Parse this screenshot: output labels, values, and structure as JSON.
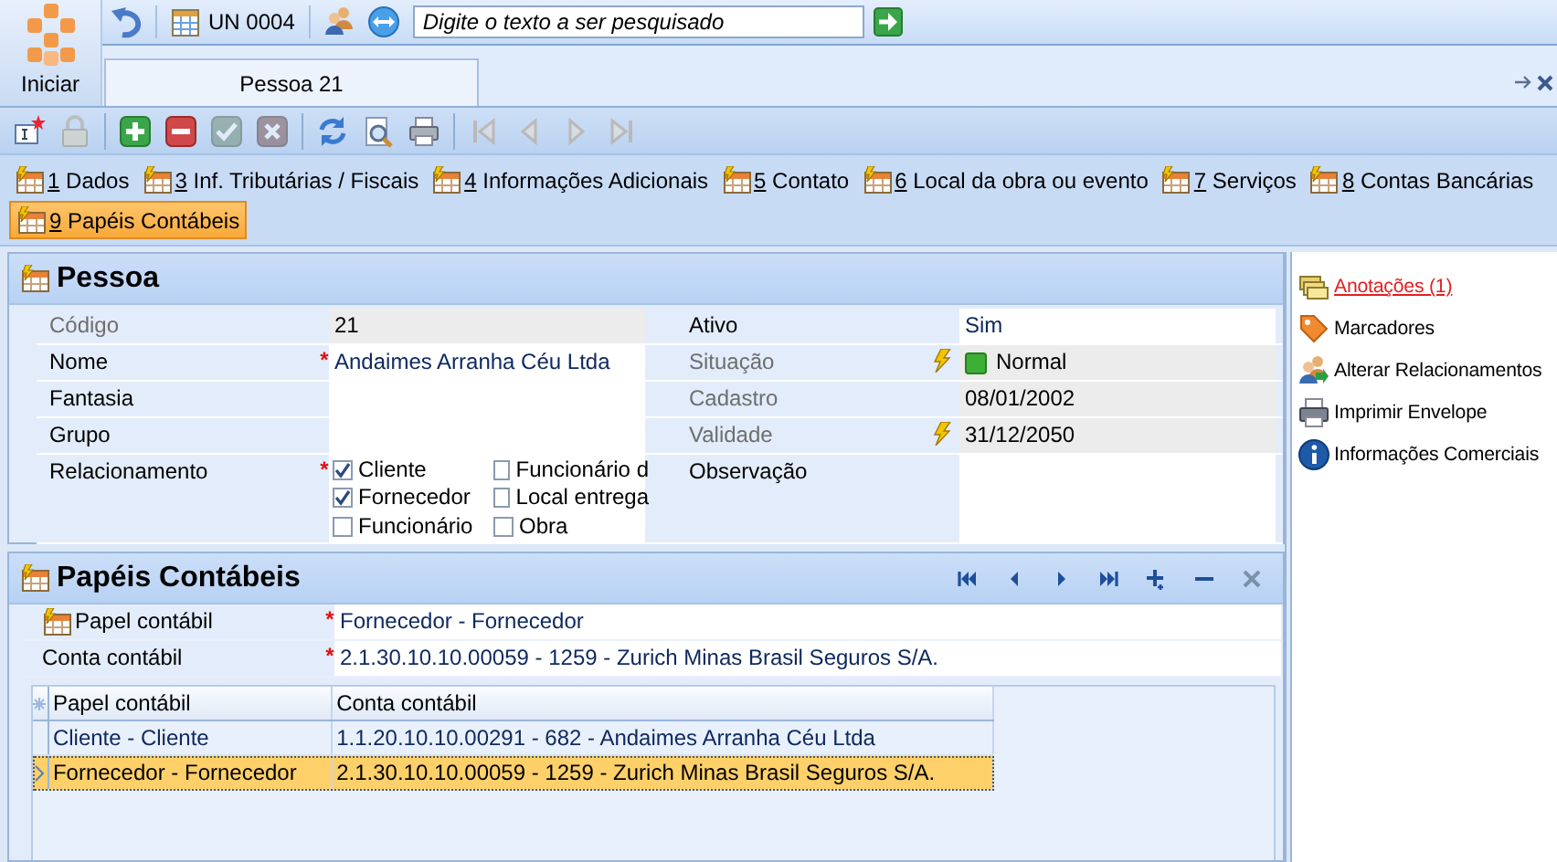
{
  "start": {
    "label": "Iniciar"
  },
  "quick_bar": {
    "unit": "UN 0004",
    "search": {
      "placeholder": "Digite o texto a ser pesquisado"
    }
  },
  "document_tabs": [
    {
      "label": "Pessoa 21",
      "selected": true
    }
  ],
  "toolbar": [
    {
      "kind": "new",
      "disabled": false
    },
    {
      "kind": "lock",
      "disabled": true
    },
    {
      "kind": "separator"
    },
    {
      "kind": "add",
      "disabled": false
    },
    {
      "kind": "remove",
      "disabled": false
    },
    {
      "kind": "confirm",
      "disabled": true
    },
    {
      "kind": "cancel",
      "disabled": true
    },
    {
      "kind": "separator"
    },
    {
      "kind": "refresh",
      "disabled": false
    },
    {
      "kind": "preview",
      "disabled": false
    },
    {
      "kind": "print",
      "disabled": false
    },
    {
      "kind": "separator"
    },
    {
      "kind": "first",
      "disabled": true
    },
    {
      "kind": "prev",
      "disabled": true
    },
    {
      "kind": "next",
      "disabled": true
    },
    {
      "kind": "last",
      "disabled": true
    }
  ],
  "section_tab_rows": [
    [
      {
        "key": "1",
        "label": "Dados",
        "selected": false
      },
      {
        "key": "3",
        "label": "Inf. Tributárias / Fiscais",
        "selected": false
      },
      {
        "key": "4",
        "label": "Informações Adicionais",
        "selected": false
      },
      {
        "key": "5",
        "label": "Contato",
        "selected": false
      },
      {
        "key": "6",
        "label": "Local da obra ou evento",
        "selected": false
      },
      {
        "key": "7",
        "label": "Serviços",
        "selected": false
      },
      {
        "key": "8",
        "label": "Contas Bancárias",
        "selected": false
      }
    ],
    [
      {
        "key": "9",
        "label": "Papéis Contábeis",
        "selected": true
      }
    ]
  ],
  "pessoa": {
    "title": "Pessoa",
    "rows": [
      {
        "left": {
          "kind": "text",
          "label": "Código",
          "value": "21",
          "readonly": true,
          "lookup": false
        },
        "right": {
          "kind": "text",
          "label": "Ativo",
          "value": "Sim",
          "readonly": false,
          "lookup": false
        }
      },
      {
        "left": {
          "kind": "text",
          "label": "Nome",
          "value": "Andaimes Arranha Céu Ltda",
          "readonly": false,
          "required_mark": "*",
          "lookup": false
        },
        "right": {
          "kind": "status",
          "label": "Situação",
          "value": "Normal",
          "readonly": true,
          "lookup": true
        }
      },
      {
        "left": {
          "kind": "text",
          "label": "Fantasia",
          "readonly": false,
          "lookup": false
        },
        "right": {
          "kind": "text",
          "label": "Cadastro",
          "value": "08/01/2002",
          "readonly": true,
          "lookup": false
        }
      },
      {
        "left": {
          "kind": "text",
          "label": "Grupo",
          "readonly": false,
          "lookup": false
        },
        "right": {
          "kind": "text",
          "label": "Validade",
          "value": "31/12/2050",
          "readonly": true,
          "lookup": true
        }
      },
      {
        "left": {
          "kind": "checks",
          "label": "Relacionamento",
          "readonly": false,
          "required_mark": "*",
          "lookup": false,
          "options": [
            {
              "label": "Cliente",
              "checked": true
            },
            {
              "label": "Funcionário d",
              "checked": false
            },
            {
              "label": "Fornecedor",
              "checked": true
            },
            {
              "label": "Local entrega",
              "checked": false
            },
            {
              "label": "Funcionário",
              "checked": false
            },
            {
              "label": "Obra",
              "checked": false
            }
          ]
        },
        "right": {
          "kind": "memo",
          "label": "Observação",
          "readonly": false,
          "lookup": false
        }
      }
    ]
  },
  "papeis": {
    "title": "Papéis Contábeis",
    "nav": [
      {
        "kind": "first",
        "disabled": false
      },
      {
        "kind": "prev",
        "disabled": false
      },
      {
        "kind": "next",
        "disabled": false
      },
      {
        "kind": "last",
        "disabled": false
      },
      {
        "kind": "add",
        "disabled": false
      },
      {
        "kind": "remove",
        "disabled": false
      },
      {
        "kind": "close",
        "disabled": true
      }
    ],
    "fields": [
      {
        "kind": "picker",
        "label": "Papel contábil",
        "value": "Fornecedor - Fornecedor",
        "required_mark": "*"
      },
      {
        "kind": "text",
        "label": "Conta contábil",
        "value": "2.1.30.10.10.00059 - 1259 - Zurich Minas Brasil Seguros S/A.",
        "required_mark": "*"
      }
    ],
    "grid": {
      "columns": [
        "Papel contábil",
        "Conta contábil"
      ],
      "rows": [
        {
          "cells": [
            "Cliente - Cliente",
            "1.1.20.10.10.00291 - 682 - Andaimes Arranha Céu Ltda"
          ],
          "selected": false
        },
        {
          "cells": [
            "Fornecedor - Fornecedor",
            "2.1.30.10.10.00059 - 1259 - Zurich Minas Brasil Seguros S/A."
          ],
          "selected": true
        }
      ]
    }
  },
  "actions": [
    {
      "kind": "notes",
      "label": "Anotações (1)",
      "highlighted": true
    },
    {
      "kind": "tag",
      "label": "Marcadores",
      "highlighted": false
    },
    {
      "kind": "people",
      "label": "Alterar Relacionamentos",
      "highlighted": false
    },
    {
      "kind": "print",
      "label": "Imprimir Envelope",
      "highlighted": false
    },
    {
      "kind": "info",
      "label": "Informações Comerciais",
      "highlighted": false
    }
  ]
}
